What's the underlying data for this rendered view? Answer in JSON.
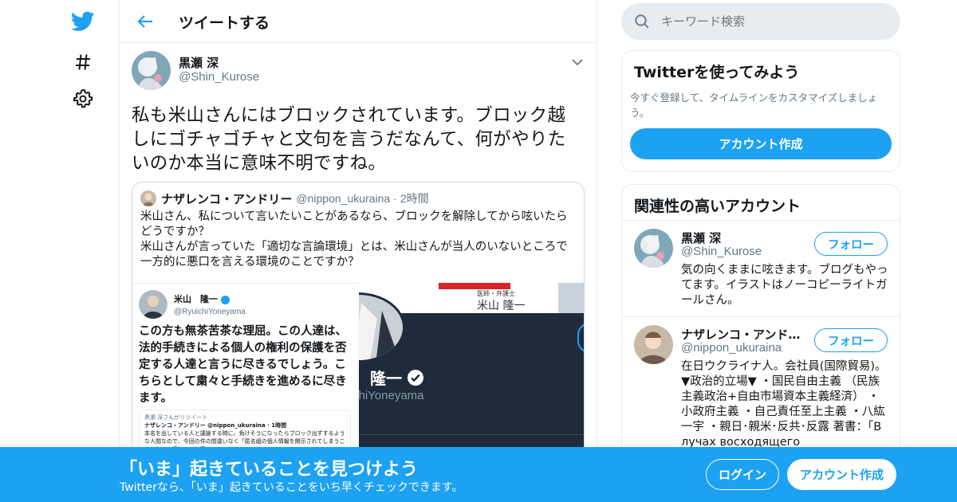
{
  "colors": {
    "accent": "#1da1f2",
    "text": "#14171a",
    "muted": "#657786",
    "border": "#e6ecf0"
  },
  "nav": {
    "items": [
      {
        "icon": "twitter-bird-icon"
      },
      {
        "icon": "hashtag-icon"
      },
      {
        "icon": "gear-icon"
      }
    ]
  },
  "header": {
    "title": "ツイートする"
  },
  "tweet": {
    "author_name": "黒瀬 深",
    "author_handle": "@Shin_Kurose",
    "text": "私も米山さんにはブロックされています。ブロック越しにゴチャゴチャと文句を言うだなんて、何がやりたいのか本当に意味不明ですね。",
    "quote": {
      "author_name": "ナザレンコ・アンドリー",
      "author_handle": "@nippon_ukuraina",
      "separator": "·",
      "time": "2時間",
      "text_line1": "米山さん、私について言いたいことがあるなら、ブロックを解除してから呟いたらどうですか？",
      "text_line2": "米山さんが言っていた「適切な言論環境」とは、米山さんが当人のいないところで一方的に悪口を言える環境のことですか？",
      "image_left": {
        "name": "米山　隆一",
        "handle": "@RyuichiYoneyama",
        "text": "この方も無茶苦茶な理屈。この人達は、法的手続きによる個人の権利の保護を否定する人達と言うに尽きるでしょう。こちらとして粛々と手続きを進めるに尽きます。",
        "retweet_by": "黒瀬 深さんがリツイート",
        "retweet_author": "ナザレンコ・アンドリー @nippon_ukuraina · 1時間",
        "retweet_text": "本名を出している人と議論する時に、負けそうになったらブロック出ずするような人間なので、今回の件の間違いなく「匿名組の個人情報を開示されてしまうことになって嬉しい」と思っていることでしょう。"
      },
      "image_right": {
        "banner_label": "医師・弁護士",
        "banner_name": "米山 隆一",
        "profile_name": "隆一",
        "profile_handle": "@RyuichiYoneyama",
        "profile_handle_visible": "chiYoneyama"
      }
    }
  },
  "search": {
    "placeholder": "キーワード検索"
  },
  "signup_card": {
    "title": "Twitterを使ってみよう",
    "description": "今すぐ登録して、タイムラインをカスタマイズしましょう。",
    "button_label": "アカウント作成"
  },
  "related": {
    "title": "関連性の高いアカウント",
    "accounts": [
      {
        "name": "黒瀬 深",
        "handle": "@Shin_Kurose",
        "follow_label": "フォロー",
        "bio": "気の向くままに呟きます。ブログもやってます。イラストはノーコピーライトガールさん。"
      },
      {
        "name": "ナザレンコ・アンドリー",
        "handle": "@nippon_ukuraina",
        "follow_label": "フォロー",
        "bio": "在日ウクライナ人。会社員(国際貿易)。 ▼政治的立場▼ ・国民自由主義 （民族主義政治+自由市場資本主義経済） ・小政府主義 ・自己責任至上主義 ・八紘一宇 ・親日･親米･反共･反露 著書：「В лучах восходящего"
      }
    ]
  },
  "bottom_bar": {
    "title": "「いま」起きていることを見つけよう",
    "subtitle": "Twitterなら、「いま」起きていることをいち早くチェックできます。",
    "login_label": "ログイン",
    "signup_label": "アカウント作成"
  }
}
